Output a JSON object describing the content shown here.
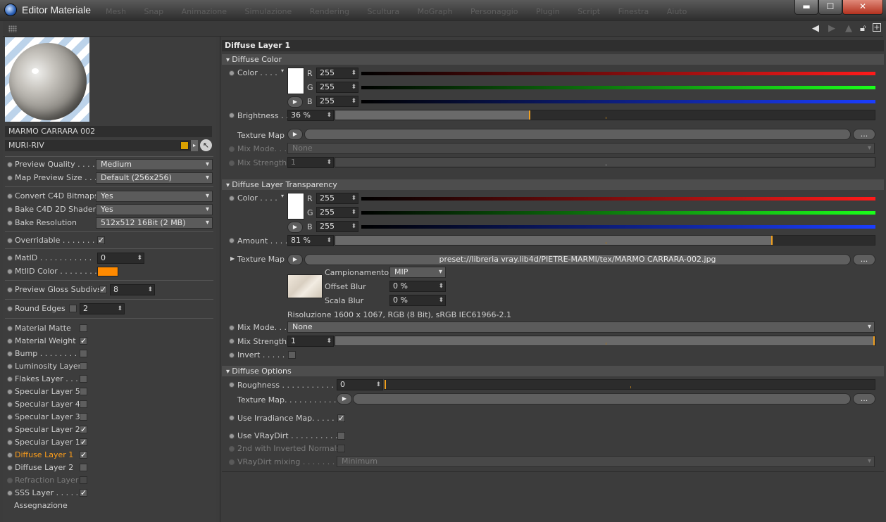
{
  "window": {
    "title": "Editor Materiale",
    "background_menu": [
      "Mesh",
      "Snap",
      "Animazione",
      "Simulazione",
      "Rendering",
      "Scultura",
      "MoGraph",
      "Personaggio",
      "Plugin",
      "Script",
      "Finestra",
      "Aiuto"
    ],
    "controls": {
      "minimize": "▬",
      "maximize": "☐",
      "close": "✕"
    }
  },
  "toolbar": {
    "icons": [
      "back-arrow-icon",
      "forward-arrow-icon",
      "up-arrow-icon",
      "lock-icon",
      "new-panel-icon"
    ]
  },
  "material": {
    "name": "MARMO CARRARA 002",
    "layer": "MURI-RIV"
  },
  "left": {
    "preview_quality": {
      "label": "Preview Quality . . . .",
      "value": "Medium"
    },
    "map_preview_size": {
      "label": "Map Preview Size . . .",
      "value": "Default (256x256)"
    },
    "convert_bitmaps": {
      "label": "Convert C4D Bitmaps",
      "value": "Yes"
    },
    "bake_shaders": {
      "label": "Bake C4D 2D Shaders",
      "value": "Yes"
    },
    "bake_resolution": {
      "label": "Bake Resolution",
      "value": "512x512  16Bit  (2 MB)"
    },
    "overridable": {
      "label": "Overridable . . . . . . . .",
      "checked": "✓"
    },
    "matid": {
      "label": "MatID . . . . . . . . . . .",
      "value": "0"
    },
    "mtlid_color": {
      "label": "MtlID Color . . . . . . . .",
      "color": "#ff8a00"
    },
    "gloss_subdivs": {
      "label": "Preview Gloss Subdivs",
      "checked": "✓",
      "value": "8"
    },
    "round_edges": {
      "label": "Round Edges",
      "value": "2"
    },
    "channels": [
      {
        "label": "Material Matte",
        "checked": "",
        "state": "normal"
      },
      {
        "label": "Material Weight",
        "checked": "✓",
        "state": "normal"
      },
      {
        "label": "Bump . . . . . . . . . .",
        "checked": "",
        "state": "normal"
      },
      {
        "label": "Luminosity Layer",
        "checked": "",
        "state": "normal"
      },
      {
        "label": "Flakes Layer . . . .",
        "checked": "",
        "state": "normal"
      },
      {
        "label": "Specular Layer 5",
        "checked": "",
        "state": "normal"
      },
      {
        "label": "Specular Layer 4",
        "checked": "",
        "state": "normal"
      },
      {
        "label": "Specular Layer 3",
        "checked": "",
        "state": "normal"
      },
      {
        "label": "Specular Layer 2",
        "checked": "✓",
        "state": "normal"
      },
      {
        "label": "Specular Layer 1",
        "checked": "✓",
        "state": "normal"
      },
      {
        "label": "Diffuse Layer 1",
        "checked": "✓",
        "state": "active"
      },
      {
        "label": "Diffuse Layer 2",
        "checked": "",
        "state": "normal"
      },
      {
        "label": "Refraction Layer",
        "checked": "",
        "state": "dim"
      },
      {
        "label": "SSS Layer . . . . . .",
        "checked": "✓",
        "state": "normal"
      }
    ],
    "assignment": "Assegnazione"
  },
  "right": {
    "header": "Diffuse Layer 1",
    "diffuse_color": {
      "group": "Diffuse Color",
      "color_label": "Color . . . .",
      "r": "255",
      "g": "255",
      "b": "255",
      "r_label": "R",
      "g_label": "G",
      "b_label": "B",
      "brightness_label": "Brightness . .",
      "brightness": "36 %",
      "brightness_fraction": 0.36,
      "texture_map_label": "Texture Map",
      "browse": "...",
      "mix_mode_label": "Mix Mode. . .",
      "mix_mode": "None",
      "mix_strength_label": "Mix Strength",
      "mix_strength": "1"
    },
    "transparency": {
      "group": "Diffuse Layer Transparency",
      "color_label": "Color . . . .",
      "r": "255",
      "g": "255",
      "b": "255",
      "amount_label": "Amount . . . .",
      "amount": "81 %",
      "amount_fraction": 0.81,
      "texture_map_label": "Texture Map",
      "texture_path": "preset://libreria vray.lib4d/PIETRE-MARMI/tex/MARMO CARRARA-002.jpg",
      "sampling_label": "Campionamento",
      "sampling": "MIP",
      "offset_blur_label": "Offset Blur",
      "offset_blur": "0 %",
      "scale_blur_label": "Scala Blur",
      "scale_blur": "0 %",
      "resolution": "Risoluzione 1600 x 1067, RGB (8 Bit), sRGB IEC61966-2.1",
      "mix_mode_label": "Mix Mode. . .",
      "mix_mode": "None",
      "mix_strength_label": "Mix Strength",
      "mix_strength": "1",
      "invert_label": "Invert . . . . . ."
    },
    "options": {
      "group": "Diffuse Options",
      "roughness_label": "Roughness . . . . . . . . . . . .",
      "roughness": "0",
      "texture_map_label": "Texture Map. . . . . . . . . . . .",
      "irradiance_label": "Use Irradiance Map. . . . . .",
      "irradiance_checked": "✓",
      "vraydirt_label": "Use VRayDirt . . . . . . . . . .",
      "inverted_label": "2nd with Inverted Normals",
      "vraydirt_mixing_label": "VRayDirt mixing . . . . . . . .",
      "vraydirt_mixing": "Minimum"
    }
  }
}
